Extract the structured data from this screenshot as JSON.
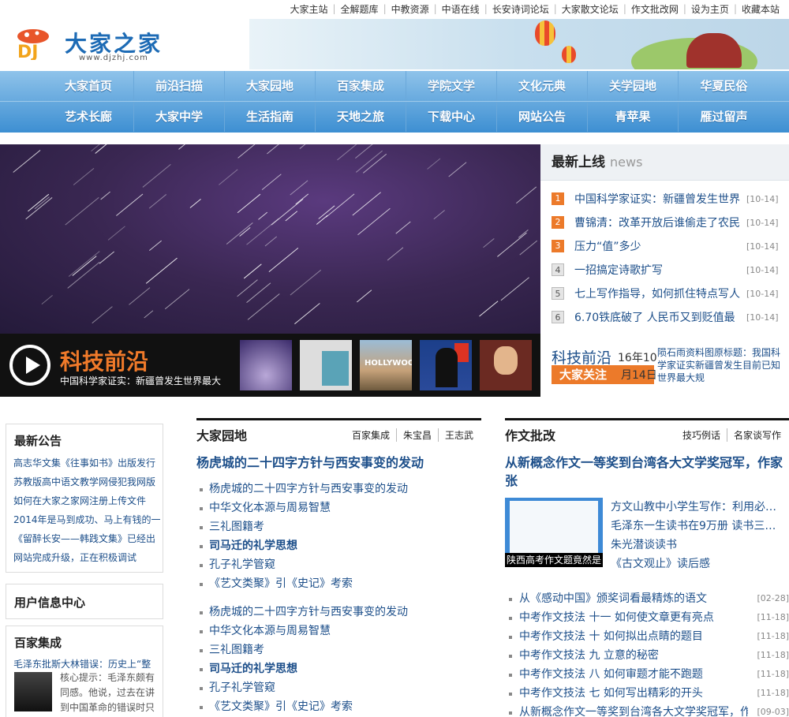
{
  "top_links": [
    "大家主站",
    "全解题库",
    "中教资源",
    "中语在线",
    "长安诗词论坛",
    "大家散文论坛",
    "作文批改网",
    "设为主页",
    "收藏本站"
  ],
  "logo": {
    "name": "大家之家",
    "url": "www.djzhj.com",
    "mark": "DJ"
  },
  "nav": {
    "row1": [
      "大家首页",
      "前沿扫描",
      "大家园地",
      "百家集成",
      "学院文学",
      "文化元典",
      "关学园地",
      "华夏民俗"
    ],
    "row2": [
      "艺术长廊",
      "大家中学",
      "生活指南",
      "天地之旅",
      "下载中心",
      "网站公告",
      "青苹果",
      "雁过留声"
    ]
  },
  "hero": {
    "title": "科技前沿",
    "subtitle": "中国科学家证实：新疆曾发生世界最大",
    "thumbs": [
      "night-sky-thumb",
      "book-cover-thumb",
      "hollywood-sign-thumb",
      "press-conference-thumb",
      "portrait-thumb"
    ],
    "thumb_text": {
      "hollywood": "HOLLYWOOD"
    }
  },
  "latest": {
    "title": "最新上线",
    "title_en": "news",
    "items": [
      {
        "rank": "1",
        "text": "中国科学家证实：新疆曾发生世界",
        "date": "[10-14]"
      },
      {
        "rank": "2",
        "text": "曹锦清：改革开放后谁偷走了农民",
        "date": "[10-14]"
      },
      {
        "rank": "3",
        "text": "压力“值”多少",
        "date": "[10-14]"
      },
      {
        "rank": "4",
        "text": "一招搞定诗歌扩写",
        "date": "[10-14]"
      },
      {
        "rank": "5",
        "text": "七上写作指导，如何抓住特点写人",
        "date": "[10-14]"
      },
      {
        "rank": "6",
        "text": "6.70铁底破了 人民币又到贬值最",
        "date": "[10-14]"
      }
    ],
    "headline": {
      "title": "科技前沿",
      "date_a": "16年10",
      "date_b": "月14日",
      "follow": "大家关注",
      "desc": "陨石雨资料图原标题：我国科学家证实新疆曾发生目前已知世界最大规"
    }
  },
  "notice": {
    "title": "最新公告",
    "items": [
      "高志华文集《往事如书》出版发行",
      "苏教版高中语文教学网侵犯我网版",
      "如何在大家之家网注册上传文件",
      "2014年是马到成功、马上有钱的一",
      "《留醉长安——韩践文集》已经出",
      "网站完成升级，正在积极调试"
    ]
  },
  "user_center": {
    "title": "用户信息中心"
  },
  "baijia": {
    "title": "百家集成",
    "line": "毛泽东批斯大林错误：历史上“整",
    "desc": "核心提示：毛泽东颇有同感。他说，过去在讲到中国革命的错误时只"
  },
  "garden": {
    "title": "大家园地",
    "tabs": [
      "百家集成",
      "朱宝昌",
      "王志武"
    ],
    "feature": "杨虎城的二十四字方针与西安事变的发动",
    "list1": [
      {
        "text": "杨虎城的二十四字方针与西安事变的发动",
        "bold": false
      },
      {
        "text": "中华文化本源与周易智慧",
        "bold": false
      },
      {
        "text": "三礼图籍考",
        "bold": false
      },
      {
        "text": "司马迁的礼学思想",
        "bold": true
      },
      {
        "text": "孔子礼学管窥",
        "bold": false
      },
      {
        "text": "《艺文类聚》引《史记》考索",
        "bold": false
      }
    ],
    "list2": [
      {
        "text": "杨虎城的二十四字方针与西安事变的发动",
        "bold": false
      },
      {
        "text": "中华文化本源与周易智慧",
        "bold": false
      },
      {
        "text": "三礼图籍考",
        "bold": false
      },
      {
        "text": "司马迁的礼学思想",
        "bold": true
      },
      {
        "text": "孔子礼学管窥",
        "bold": false
      },
      {
        "text": "《艺文类聚》引《史记》考索",
        "bold": false
      }
    ]
  },
  "essay": {
    "title": "作文批改",
    "tabs": [
      "技巧例话",
      "名家谈写作"
    ],
    "feature": "从新概念作文一等奖到台湾各大文学奖冠军，作家张",
    "pic_caption": "陕西高考作文题竟然是",
    "side": [
      "方文山教中小学生写作：利用必…",
      "毛泽东一生读书在9万册 读书三…",
      "朱光潜谈读书",
      "《古文观止》读后感"
    ],
    "list": [
      {
        "text": "从《感动中国》颁奖词看最精炼的语文",
        "date": "[02-28]"
      },
      {
        "text": "中考作文技法 十一 如何使文章更有亮点",
        "date": "[11-18]"
      },
      {
        "text": "中考作文技法 十 如何拟出点睛的题目",
        "date": "[11-18]"
      },
      {
        "text": "中考作文技法 九 立意的秘密",
        "date": "[11-18]"
      },
      {
        "text": "中考作文技法 八 如何审题才能不跑题",
        "date": "[11-18]"
      },
      {
        "text": "中考作文技法 七 如何写出精彩的开头",
        "date": "[11-18]"
      },
      {
        "text": "从新概念作文一等奖到台湾各大文学奖冠军，作",
        "date": "[09-03]"
      }
    ]
  },
  "colors": {
    "nav_top": "#8fc3ea",
    "nav_bottom": "#3d8fd2",
    "accent_orange": "#ec7a2a",
    "link_blue": "#1d4f8a"
  }
}
